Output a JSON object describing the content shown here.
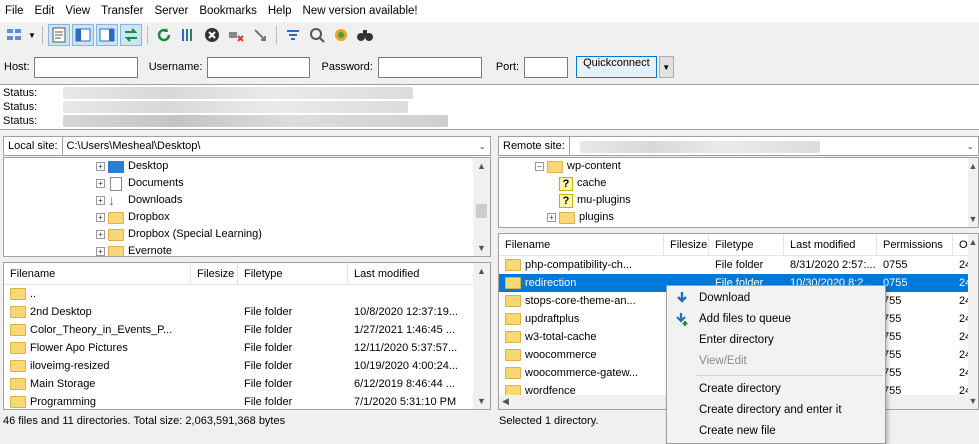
{
  "menu": [
    "File",
    "Edit",
    "View",
    "Transfer",
    "Server",
    "Bookmarks",
    "Help",
    "New version available!"
  ],
  "toolbar_icons": [
    "site-manager-icon",
    "toggle-log-icon",
    "toggle-local-tree-icon",
    "toggle-remote-tree-icon",
    "transfer-queue-icon",
    "refresh-icon",
    "process-queue-icon",
    "cancel-icon",
    "disconnect-icon",
    "reconnect-icon",
    "filter-icon",
    "compare-icon",
    "sync-browse-icon",
    "search-icon"
  ],
  "quickconnect": {
    "host_label": "Host:",
    "username_label": "Username:",
    "password_label": "Password:",
    "port_label": "Port:",
    "button": "Quickconnect"
  },
  "log": [
    {
      "label": "Status:"
    },
    {
      "label": "Status:"
    },
    {
      "label": "Status:"
    }
  ],
  "local": {
    "site_label": "Local site:",
    "path": "C:\\Users\\Mesheal\\Desktop\\",
    "tree": [
      {
        "label": "Desktop",
        "icon": "desktop"
      },
      {
        "label": "Documents",
        "icon": "documents"
      },
      {
        "label": "Downloads",
        "icon": "downloads"
      },
      {
        "label": "Dropbox",
        "icon": "folder"
      },
      {
        "label": "Dropbox (Special Learning)",
        "icon": "folder"
      },
      {
        "label": "Evernote",
        "icon": "folder"
      }
    ],
    "columns": [
      "Filename",
      "Filesize",
      "Filetype",
      "Last modified"
    ],
    "files": [
      {
        "name": "..",
        "size": "",
        "type": "",
        "modified": ""
      },
      {
        "name": "2nd Desktop",
        "size": "",
        "type": "File folder",
        "modified": "10/8/2020 12:37:19..."
      },
      {
        "name": "Color_Theory_in_Events_P...",
        "size": "",
        "type": "File folder",
        "modified": "1/27/2021 1:46:45 ..."
      },
      {
        "name": "Flower Apo Pictures",
        "size": "",
        "type": "File folder",
        "modified": "12/11/2020 5:37:57..."
      },
      {
        "name": "iloveimg-resized",
        "size": "",
        "type": "File folder",
        "modified": "10/19/2020 4:00:24..."
      },
      {
        "name": "Main Storage",
        "size": "",
        "type": "File folder",
        "modified": "6/12/2019 8:46:44 ..."
      },
      {
        "name": "Programming",
        "size": "",
        "type": "File folder",
        "modified": "7/1/2020 5:31:10 PM"
      }
    ],
    "status": "46 files and 11 directories. Total size: 2,063,591,368 bytes"
  },
  "remote": {
    "site_label": "Remote site:",
    "tree": [
      {
        "label": "wp-content",
        "icon": "folder",
        "expanded": true
      },
      {
        "label": "cache",
        "icon": "unknown"
      },
      {
        "label": "mu-plugins",
        "icon": "unknown"
      },
      {
        "label": "plugins",
        "icon": "folder"
      }
    ],
    "columns": [
      "Filename",
      "Filesize",
      "Filetype",
      "Last modified",
      "Permissions",
      "O"
    ],
    "files": [
      {
        "name": "php-compatibility-ch...",
        "size": "",
        "type": "File folder",
        "modified": "8/31/2020 2:57:...",
        "perm": "0755",
        "owner": "24"
      },
      {
        "name": "redirection",
        "size": "",
        "type": "File folder",
        "modified": "10/30/2020 8:2...",
        "perm": "0755",
        "owner": "24",
        "selected": true
      },
      {
        "name": "stops-core-theme-an...",
        "size": "",
        "type": "",
        "modified": "",
        "perm": "755",
        "owner": "24"
      },
      {
        "name": "updraftplus",
        "size": "",
        "type": "",
        "modified": "",
        "perm": "755",
        "owner": "24"
      },
      {
        "name": "w3-total-cache",
        "size": "",
        "type": "",
        "modified": "",
        "perm": "755",
        "owner": "24"
      },
      {
        "name": "woocommerce",
        "size": "",
        "type": "",
        "modified": "",
        "perm": "755",
        "owner": "24"
      },
      {
        "name": "woocommerce-gatew...",
        "size": "",
        "type": "",
        "modified": "",
        "perm": "755",
        "owner": "24"
      },
      {
        "name": "wordfence",
        "size": "",
        "type": "",
        "modified": "",
        "perm": "755",
        "owner": "24"
      }
    ],
    "status": "Selected 1 directory."
  },
  "context_menu": [
    {
      "label": "Download",
      "icon": "download-arrow-icon",
      "disabled": false
    },
    {
      "label": "Add files to queue",
      "icon": "add-to-queue-icon",
      "disabled": false
    },
    {
      "label": "Enter directory",
      "disabled": false
    },
    {
      "label": "View/Edit",
      "disabled": true
    },
    {
      "separator": true
    },
    {
      "label": "Create directory",
      "disabled": false
    },
    {
      "label": "Create directory and enter it",
      "disabled": false
    },
    {
      "label": "Create new file",
      "disabled": false
    }
  ],
  "colors": {
    "selection": "#0078d7",
    "folder": "#f8d775",
    "accent_border": "#0078d7"
  }
}
